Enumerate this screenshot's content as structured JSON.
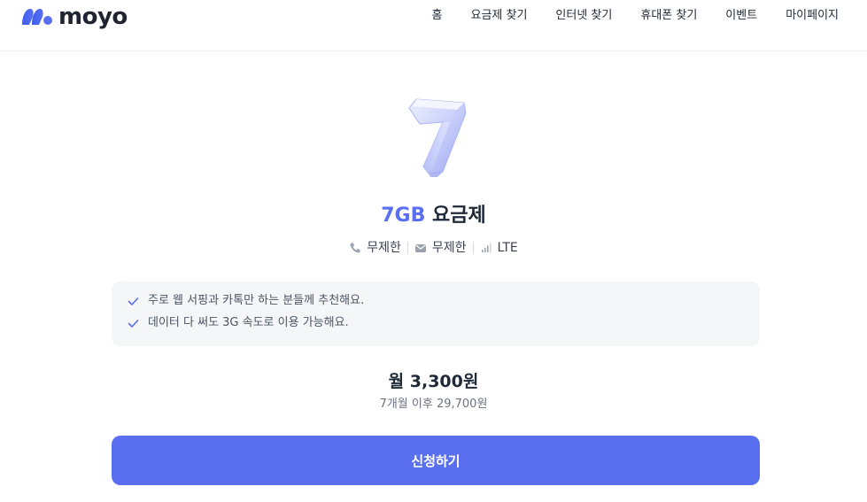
{
  "header": {
    "logo_text": "moyo",
    "nav": [
      "홈",
      "요금제 찾기",
      "인터넷 찾기",
      "휴대폰 찾기",
      "이벤트",
      "마이페이지"
    ]
  },
  "hero": {
    "icon": "number-7-3d-icon"
  },
  "plan": {
    "data_amount": "7GB",
    "title_suffix": " 요금제",
    "specs": [
      {
        "icon": "phone-icon",
        "label": "무제한"
      },
      {
        "icon": "message-icon",
        "label": "무제한"
      },
      {
        "icon": "signal-icon",
        "label": "LTE"
      }
    ]
  },
  "info": {
    "items": [
      "주로 웹 서핑과 카톡만 하는 분들께 추천해요.",
      "데이터 다 써도 3G 속도로 이용 가능해요."
    ]
  },
  "price": {
    "main": "월 3,300원",
    "after": "7개월 이후 29,700원"
  },
  "cta": {
    "label": "신청하기"
  },
  "colors": {
    "accent": "#5a6ff0",
    "text": "#1f2937",
    "muted": "#6b7280",
    "box": "#f5f6f8"
  }
}
